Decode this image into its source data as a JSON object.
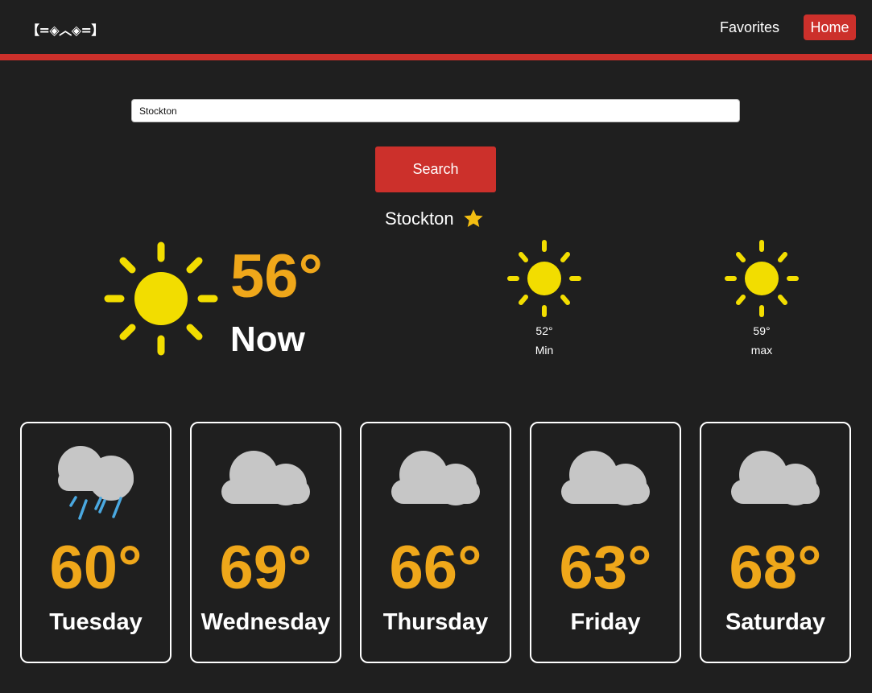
{
  "header": {
    "logo": "【=◈︿◈=】",
    "nav": {
      "favorites": "Favorites",
      "home": "Home"
    }
  },
  "colors": {
    "background": "#1f1f1f",
    "accent_red": "#cc302b",
    "temp_orange": "#efa71a",
    "sun_yellow": "#f2dd00",
    "cloud_gray": "#c6c6c6",
    "rain_blue": "#4aa8e0",
    "star_gold": "#f3be12"
  },
  "search": {
    "value": "Stockton",
    "button_label": "Search"
  },
  "current": {
    "city": "Stockton",
    "favorite_icon": "star-icon",
    "condition_icon": "sun-icon",
    "temp": "56°",
    "label": "Now",
    "min": {
      "icon": "sun-icon",
      "temp": "52°",
      "label": "Min"
    },
    "max": {
      "icon": "sun-icon",
      "temp": "59°",
      "label": "max"
    }
  },
  "forecast": [
    {
      "day": "Tuesday",
      "temp": "60°",
      "icon": "rain-cloud-icon"
    },
    {
      "day": "Wednesday",
      "temp": "69°",
      "icon": "cloud-icon"
    },
    {
      "day": "Thursday",
      "temp": "66°",
      "icon": "cloud-icon"
    },
    {
      "day": "Friday",
      "temp": "63°",
      "icon": "cloud-icon"
    },
    {
      "day": "Saturday",
      "temp": "68°",
      "icon": "cloud-icon"
    }
  ]
}
